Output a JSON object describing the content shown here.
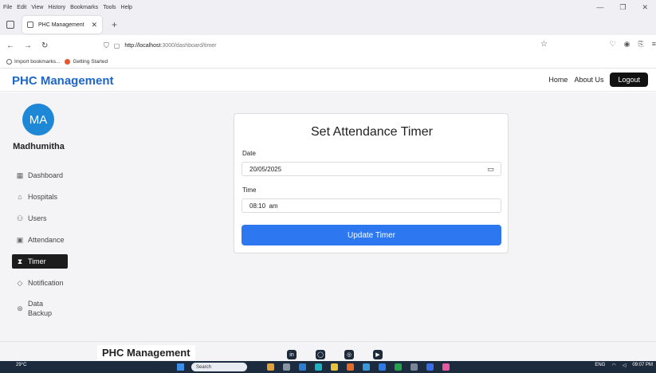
{
  "browser": {
    "menu": [
      "File",
      "Edit",
      "View",
      "History",
      "Bookmarks",
      "Tools",
      "Help"
    ],
    "window_controls": [
      "—",
      "❐",
      "✕"
    ],
    "tab_title": "PHC Management",
    "tab_close": "✕",
    "new_tab": "+",
    "url_host": "http://localhost",
    "url_rest": ":3000/dashboard/timer",
    "bookmarks": [
      "Import bookmarks...",
      "Getting Started"
    ]
  },
  "app": {
    "brand": "PHC Management",
    "nav": {
      "home": "Home",
      "about": "About Us",
      "logout": "Logout"
    }
  },
  "sidebar": {
    "avatar_initials": "MA",
    "user_name": "Madhumitha",
    "items": [
      {
        "label": "Dashboard",
        "icon": "grid-icon"
      },
      {
        "label": "Hospitals",
        "icon": "hospital-icon"
      },
      {
        "label": "Users",
        "icon": "users-icon"
      },
      {
        "label": "Attendance",
        "icon": "calendar-icon"
      },
      {
        "label": "Timer",
        "icon": "hourglass-icon"
      },
      {
        "label": "Notification",
        "icon": "bell-icon"
      },
      {
        "label": "Data\nBackup",
        "icon": "backup-icon"
      }
    ],
    "active": "Timer"
  },
  "form": {
    "title": "Set Attendance Timer",
    "date_label": "Date",
    "date_value": "20/05/2025",
    "time_label": "Time",
    "time_value": "08:10  am",
    "submit_label": "Update Timer"
  },
  "footer": {
    "brand": "PHC Management",
    "social": [
      "linkedin-icon",
      "github-icon",
      "instagram-icon",
      "youtube-icon"
    ]
  },
  "taskbar": {
    "weather": "29°C",
    "search": "Search",
    "lang": "ENG",
    "time": "09:07 PM"
  },
  "colors": {
    "brand": "#1e66c8",
    "primary_button": "#2d78f0",
    "avatar": "#1e88d6",
    "active_item": "#1c1c1c"
  }
}
